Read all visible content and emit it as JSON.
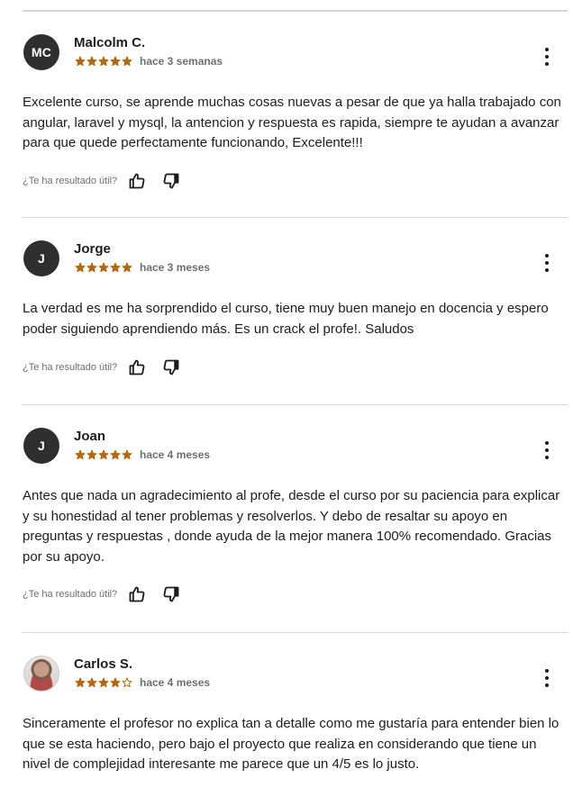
{
  "helpful_prompt": "¿Te ha resultado útil?",
  "colors": {
    "star": "#b4690e",
    "avatar_bg": "#2d2f31",
    "divider": "#d1d7dc",
    "muted_text": "#6a6f73"
  },
  "icons": {
    "menu": "more-vertical-icon",
    "thumbs_up": "thumbs-up-icon",
    "thumbs_down": "thumbs-down-icon",
    "star": "star-icon"
  },
  "reviews": [
    {
      "initials": "MC",
      "name": "Malcolm C.",
      "rating": 5,
      "time": "hace 3 semanas",
      "text": "Excelente curso, se aprende muchas cosas nuevas a pesar de que ya halla trabajado con angular, laravel y mysql, la antencion y respuesta es rapida, siempre te ayudan a avanzar para que quede perfectamente funcionando, Excelente!!!"
    },
    {
      "initials": "J",
      "name": "Jorge",
      "rating": 5,
      "time": "hace 3 meses",
      "text": "La verdad es me ha sorprendido el curso, tiene muy buen manejo en docencia y espero poder siguiendo aprendiendo más. Es un crack el profe!. Saludos"
    },
    {
      "initials": "J",
      "name": "Joan",
      "rating": 5,
      "time": "hace 4 meses",
      "text": "Antes que nada un agradecimiento al profe, desde el curso por su paciencia para explicar y su honestidad al tener problemas y resolverlos. Y debo de resaltar su apoyo en preguntas y respuestas , donde ayuda de la mejor manera 100% recomendado. Gracias por su apoyo."
    },
    {
      "initials": "",
      "name": "Carlos S.",
      "rating": 4,
      "time": "hace 4 meses",
      "text": "Sinceramente el profesor no explica tan a detalle como me gustaría para entender bien lo que se esta haciendo, pero bajo el proyecto que realiza en considerando que tiene un nivel de complejidad interesante me parece que un 4/5 es lo justo."
    }
  ]
}
